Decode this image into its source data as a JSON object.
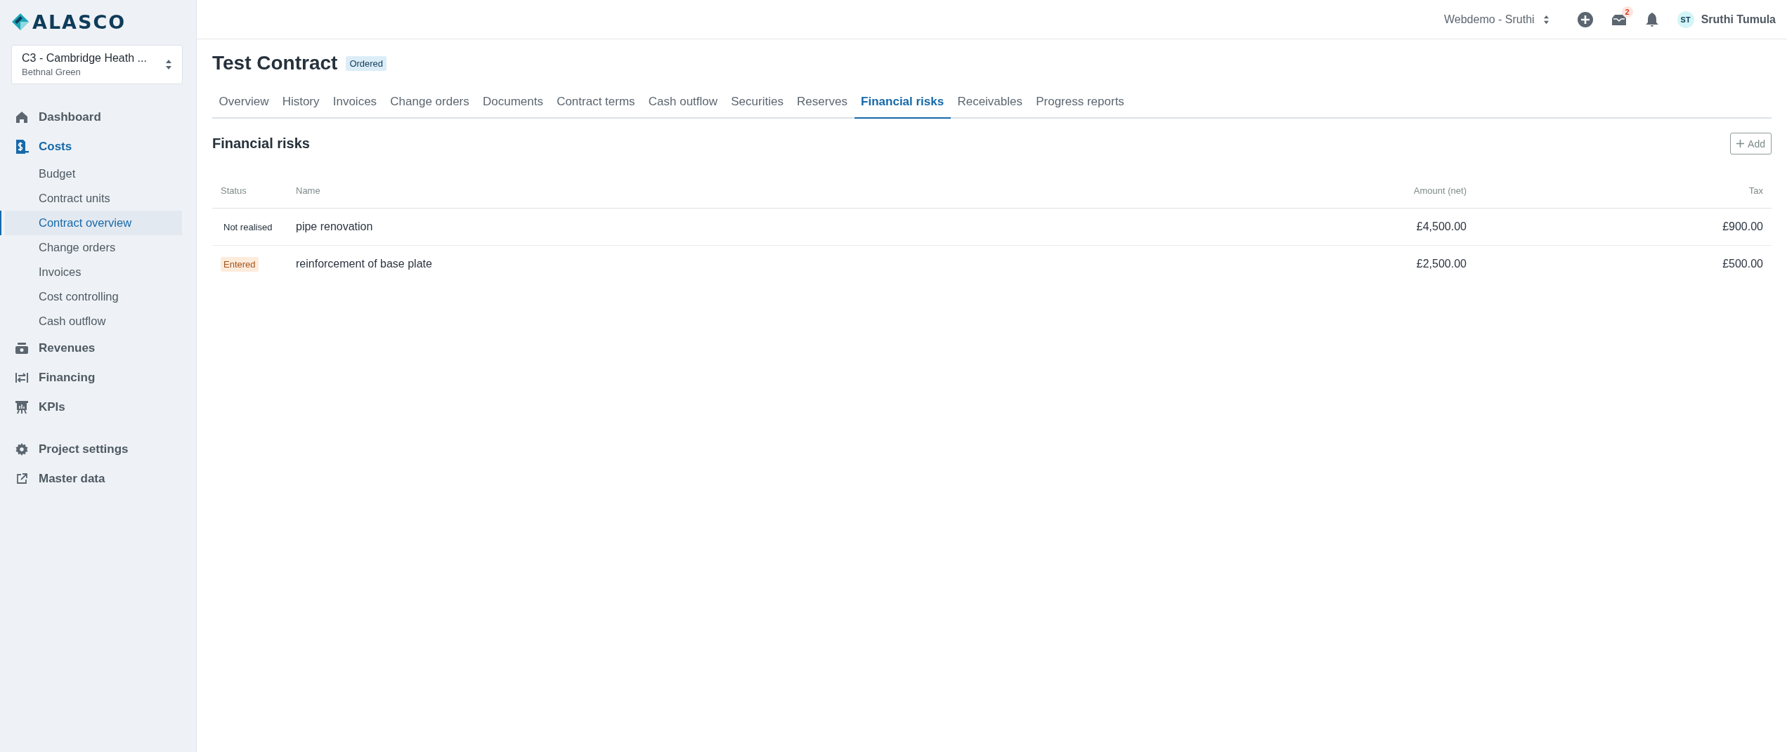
{
  "sidebar": {
    "logo": "ALASCO",
    "project": {
      "name": "C3 - Cambridge Heath ...",
      "location": "Bethnal Green"
    },
    "nav": [
      {
        "label": "Dashboard",
        "selected": false
      },
      {
        "label": "Costs",
        "selected": true,
        "children": [
          {
            "label": "Budget",
            "selected": false
          },
          {
            "label": "Contract units",
            "selected": false
          },
          {
            "label": "Contract overview",
            "selected": true
          },
          {
            "label": "Change orders",
            "selected": false
          },
          {
            "label": "Invoices",
            "selected": false
          },
          {
            "label": "Cost controlling",
            "selected": false
          },
          {
            "label": "Cash outflow",
            "selected": false
          }
        ]
      },
      {
        "label": "Revenues",
        "selected": false
      },
      {
        "label": "Financing",
        "selected": false
      },
      {
        "label": "KPIs",
        "selected": false
      }
    ],
    "nav_bottom": [
      {
        "label": "Project settings",
        "selected": false
      },
      {
        "label": "Master data",
        "selected": false
      }
    ]
  },
  "topbar": {
    "workspace": "Webdemo - Sruthi",
    "inbox_count": "2",
    "user_initials": "ST",
    "user_name": "Sruthi Tumula"
  },
  "contract": {
    "title": "Test Contract",
    "status": "Ordered"
  },
  "tabs": [
    {
      "label": "Overview",
      "selected": false
    },
    {
      "label": "History",
      "selected": false
    },
    {
      "label": "Invoices",
      "selected": false
    },
    {
      "label": "Change orders",
      "selected": false
    },
    {
      "label": "Documents",
      "selected": false
    },
    {
      "label": "Contract terms",
      "selected": false
    },
    {
      "label": "Cash outflow",
      "selected": false
    },
    {
      "label": "Securities",
      "selected": false
    },
    {
      "label": "Reserves",
      "selected": false
    },
    {
      "label": "Financial risks",
      "selected": true
    },
    {
      "label": "Receivables",
      "selected": false
    },
    {
      "label": "Progress reports",
      "selected": false
    }
  ],
  "section": {
    "title": "Financial risks",
    "add_button": "Add"
  },
  "table": {
    "columns": [
      "Status",
      "Name",
      "Amount (net)",
      "Tax"
    ],
    "rows": [
      {
        "status": "Not realised",
        "kind": "plain",
        "name": "pipe renovation",
        "amount": "£4,500.00",
        "tax": "£900.00"
      },
      {
        "status": "Entered",
        "kind": "warning",
        "name": "reinforcement of base plate",
        "amount": "£2,500.00",
        "tax": "£500.00"
      }
    ]
  }
}
